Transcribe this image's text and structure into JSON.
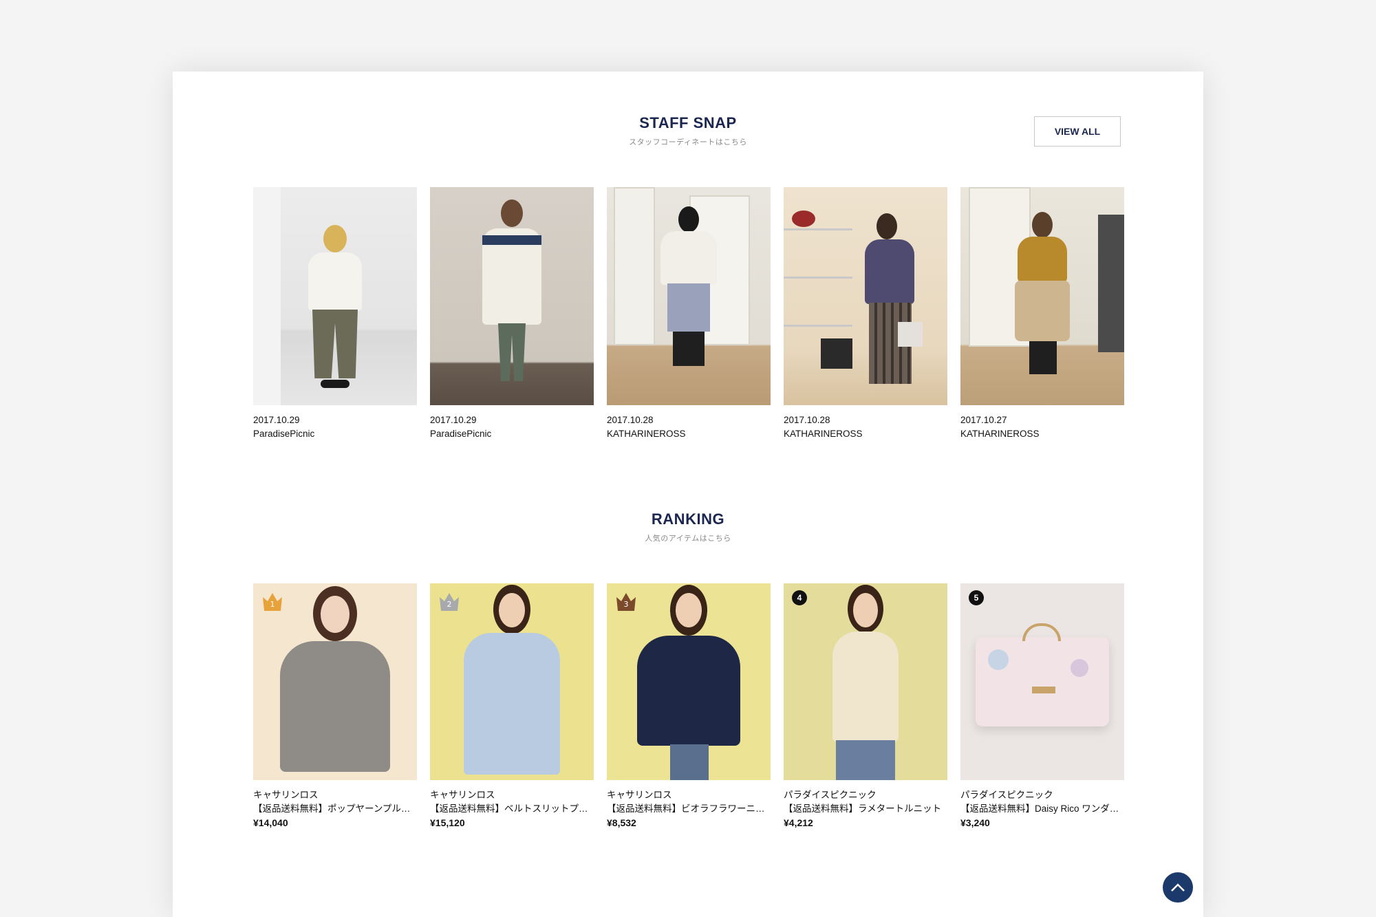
{
  "staff_snap": {
    "title": "STAFF SNAP",
    "subtitle": "スタッフコーディネートはこちら",
    "view_all_label": "VIEW ALL",
    "items": [
      {
        "date": "2017.10.29",
        "brand": "ParadisePicnic"
      },
      {
        "date": "2017.10.29",
        "brand": "ParadisePicnic"
      },
      {
        "date": "2017.10.28",
        "brand": "KATHARINEROSS"
      },
      {
        "date": "2017.10.28",
        "brand": "KATHARINEROSS"
      },
      {
        "date": "2017.10.27",
        "brand": "KATHARINEROSS"
      }
    ]
  },
  "ranking": {
    "title": "RANKING",
    "subtitle": "人気のアイテムはこちら",
    "items": [
      {
        "rank": "1",
        "brand": "キャサリンロス",
        "name": "【返品送料無料】ポップヤーンプルオーバーニット",
        "price": "¥14,040"
      },
      {
        "rank": "2",
        "brand": "キャサリンロス",
        "name": "【返品送料無料】ベルトスリットプルオーバー",
        "price": "¥15,120"
      },
      {
        "rank": "3",
        "brand": "キャサリンロス",
        "name": "【返品送料無料】ビオラフラワーニット",
        "price": "¥8,532"
      },
      {
        "rank": "4",
        "brand": "パラダイスピクニック",
        "name": "【返品送料無料】ラメタートルニット",
        "price": "¥4,212"
      },
      {
        "rank": "5",
        "brand": "パラダイスピクニック",
        "name": "【返品送料無料】Daisy Rico ワンダーポーチ",
        "price": "¥3,240"
      }
    ]
  },
  "colors": {
    "navy": "#1b2750",
    "gold": "#e8a23a",
    "silver": "#a7a9ad",
    "bronze": "#7a4a2a",
    "back_to_top": "#1b3a6b"
  },
  "icons": {
    "crown": "crown-icon",
    "back_to_top": "chevron-up-icon"
  }
}
